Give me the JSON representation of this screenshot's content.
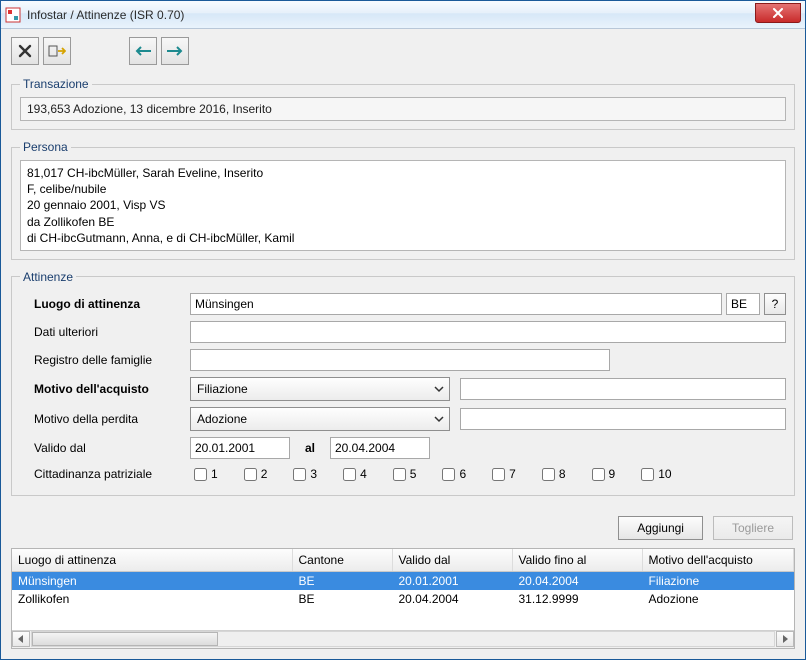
{
  "window": {
    "title": "Infostar / Attinenze (ISR 0.70)"
  },
  "toolbar": {
    "cancel_icon": "cancel",
    "export_icon": "export",
    "back_icon": "arrow-left",
    "forward_icon": "arrow-right"
  },
  "transazione": {
    "legend": "Transazione",
    "value": "193,653  Adozione, 13 dicembre 2016, Inserito"
  },
  "persona": {
    "legend": "Persona",
    "lines": "81,017  CH-ibcMüller, Sarah Eveline, Inserito\nF, celibe/nubile\n20 gennaio 2001, Visp VS\nda Zollikofen BE\ndi CH-ibcGutmann, Anna, e di CH-ibcMüller, Kamil"
  },
  "attinenze": {
    "legend": "Attinenze",
    "labels": {
      "luogo": "Luogo di attinenza",
      "canton_suffix": "BE",
      "dati_ulteriori": "Dati ulteriori",
      "registro": "Registro delle famiglie",
      "motivo_acquisto": "Motivo dell'acquisto",
      "motivo_perdita": "Motivo della perdita",
      "valido_dal": "Valido dal",
      "al": "al",
      "cittadinanza": "Cittadinanza patriziale",
      "help": "?"
    },
    "values": {
      "luogo": "Münsingen",
      "dati_ulteriori": "",
      "registro": "",
      "motivo_acquisto": "Filiazione",
      "motivo_acquisto_extra": "",
      "motivo_perdita": "Adozione",
      "motivo_perdita_extra": "",
      "valido_dal": "20.01.2001",
      "valido_al": "20.04.2004"
    },
    "patriziale_numbers": [
      "1",
      "2",
      "3",
      "4",
      "5",
      "6",
      "7",
      "8",
      "9",
      "10"
    ]
  },
  "buttons": {
    "aggiungi": "Aggiungi",
    "togliere": "Togliere"
  },
  "grid": {
    "headers": {
      "luogo": "Luogo di attinenza",
      "cantone": "Cantone",
      "valido_dal": "Valido dal",
      "valido_fino": "Valido fino al",
      "motivo": "Motivo dell'acquisto"
    },
    "rows": [
      {
        "luogo": "Münsingen",
        "cantone": "BE",
        "valido_dal": "20.01.2001",
        "valido_fino": "20.04.2004",
        "motivo": "Filiazione",
        "selected": true
      },
      {
        "luogo": "Zollikofen",
        "cantone": "BE",
        "valido_dal": "20.04.2004",
        "valido_fino": "31.12.9999",
        "motivo": "Adozione",
        "selected": false
      }
    ]
  }
}
